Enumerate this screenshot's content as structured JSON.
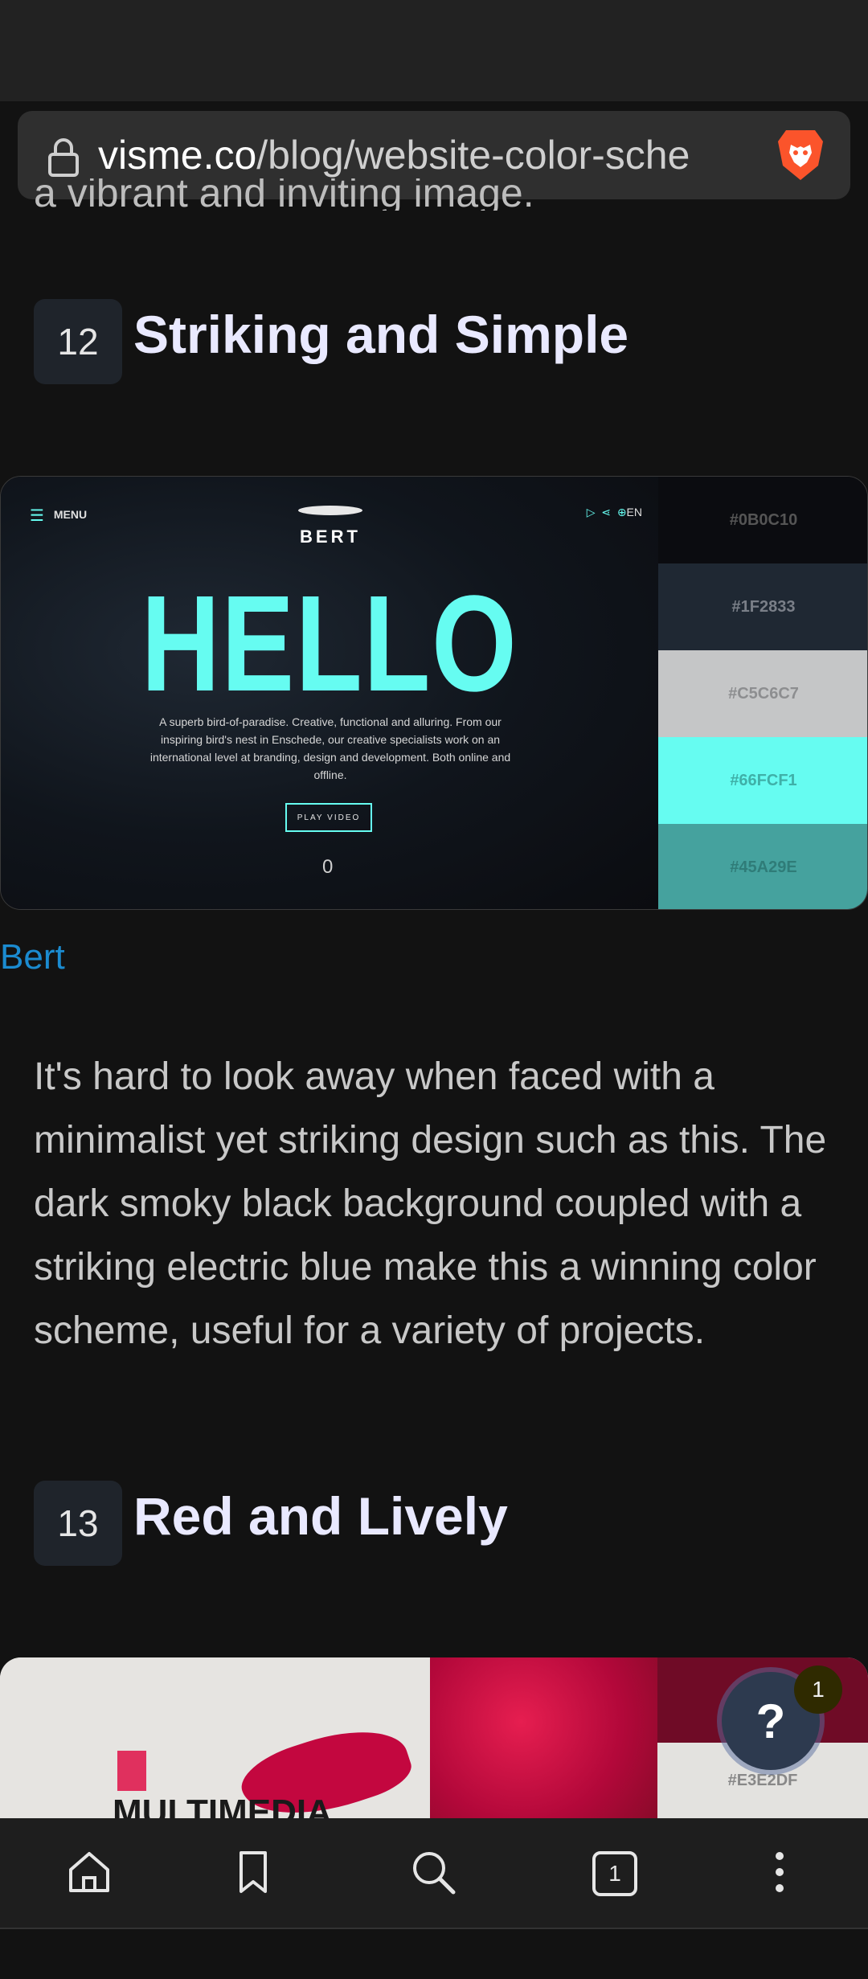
{
  "browser": {
    "url_host": "visme.co",
    "url_path": "/blog/website-color-sche"
  },
  "article": {
    "partial_prev_text": "a vibrant and inviting image.",
    "section12": {
      "number": "12",
      "title": "Striking and Simple",
      "hero": {
        "menu_label": "MENU",
        "brand": "BERT",
        "lang": "EN",
        "headline": "HELLO",
        "description": "A superb bird-of-paradise. Creative, functional and alluring. From our inspiring bird's nest in Enschede, our creative specialists work on an international level at branding, design and development. Both online and offline.",
        "play_button": "PLAY VIDEO",
        "counter": "0"
      },
      "swatches": [
        {
          "hex": "#0B0C10",
          "bg": "#0B0C10",
          "fg": "#555555"
        },
        {
          "hex": "#1F2833",
          "bg": "#1F2833",
          "fg": "#7a7f88"
        },
        {
          "hex": "#C5C6C7",
          "bg": "#C5C6C7",
          "fg": "#8d8e90"
        },
        {
          "hex": "#66FCF1",
          "bg": "#66FCF1",
          "fg": "#3fb0a8"
        },
        {
          "hex": "#45A29E",
          "bg": "#45A29E",
          "fg": "#2f7c78"
        }
      ],
      "caption_link": "Bert",
      "paragraph": "It's hard to look away when faced with a minimalist yet striking design such as this. The dark smoky black background coupled with a striking electric blue make this a winning color scheme, useful for a variety of projects."
    },
    "section13": {
      "number": "13",
      "title": "Red and Lively",
      "preview_text": "MULTIMEDIA",
      "swatch_visible": "#E3E2DF"
    }
  },
  "help_widget": {
    "symbol": "?",
    "badge_count": "1"
  },
  "bottom_nav": {
    "tab_count": "1"
  }
}
